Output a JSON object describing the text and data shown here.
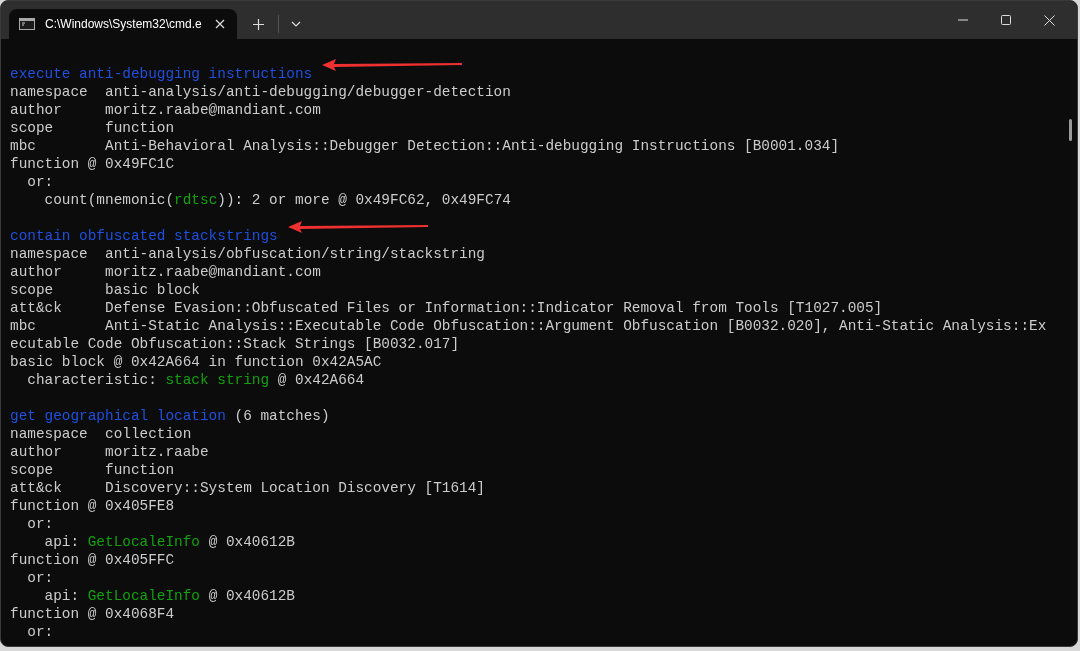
{
  "window": {
    "tab_title": "C:\\Windows\\System32\\cmd.e"
  },
  "blocks": [
    {
      "arrow": true,
      "lines": [
        {
          "segments": [
            {
              "text": "execute anti-debugging instructions",
              "kind": "heading"
            }
          ]
        },
        {
          "segments": [
            {
              "text": "namespace  anti-analysis/anti-debugging/debugger-detection",
              "kind": "plain"
            }
          ]
        },
        {
          "segments": [
            {
              "text": "author     moritz.raabe@mandiant.com",
              "kind": "plain"
            }
          ]
        },
        {
          "segments": [
            {
              "text": "scope      function",
              "kind": "plain"
            }
          ]
        },
        {
          "segments": [
            {
              "text": "mbc        Anti-Behavioral Analysis::Debugger Detection::Anti-debugging Instructions [B0001.034]",
              "kind": "plain"
            }
          ]
        },
        {
          "segments": [
            {
              "text": "function @ 0x49FC1C",
              "kind": "plain"
            }
          ]
        },
        {
          "segments": [
            {
              "text": "  or:",
              "kind": "plain"
            }
          ]
        },
        {
          "segments": [
            {
              "text": "    count(mnemonic(",
              "kind": "plain"
            },
            {
              "text": "rdtsc",
              "kind": "match"
            },
            {
              "text": ")): 2 or more @ 0x49FC62, 0x49FC74",
              "kind": "plain"
            }
          ]
        }
      ]
    },
    {
      "arrow": true,
      "lines": [
        {
          "segments": [
            {
              "text": "contain obfuscated stackstrings",
              "kind": "heading"
            }
          ]
        },
        {
          "segments": [
            {
              "text": "namespace  anti-analysis/obfuscation/string/stackstring",
              "kind": "plain"
            }
          ]
        },
        {
          "segments": [
            {
              "text": "author     moritz.raabe@mandiant.com",
              "kind": "plain"
            }
          ]
        },
        {
          "segments": [
            {
              "text": "scope      basic block",
              "kind": "plain"
            }
          ]
        },
        {
          "segments": [
            {
              "text": "att&ck     Defense Evasion::Obfuscated Files or Information::Indicator Removal from Tools [T1027.005]",
              "kind": "plain"
            }
          ]
        },
        {
          "segments": [
            {
              "text": "mbc        Anti-Static Analysis::Executable Code Obfuscation::Argument Obfuscation [B0032.020], Anti-Static Analysis::Ex",
              "kind": "plain"
            }
          ]
        },
        {
          "segments": [
            {
              "text": "ecutable Code Obfuscation::Stack Strings [B0032.017]",
              "kind": "plain"
            }
          ]
        },
        {
          "segments": [
            {
              "text": "basic block @ 0x42A664 in function 0x42A5AC",
              "kind": "plain"
            }
          ]
        },
        {
          "segments": [
            {
              "text": "  characteristic: ",
              "kind": "plain"
            },
            {
              "text": "stack string",
              "kind": "match"
            },
            {
              "text": " @ 0x42A664",
              "kind": "plain"
            }
          ]
        }
      ]
    },
    {
      "arrow": false,
      "lines": [
        {
          "segments": [
            {
              "text": "get geographical location",
              "kind": "heading"
            },
            {
              "text": " (6 matches)",
              "kind": "plain"
            }
          ]
        },
        {
          "segments": [
            {
              "text": "namespace  collection",
              "kind": "plain"
            }
          ]
        },
        {
          "segments": [
            {
              "text": "author     moritz.raabe",
              "kind": "plain"
            }
          ]
        },
        {
          "segments": [
            {
              "text": "scope      function",
              "kind": "plain"
            }
          ]
        },
        {
          "segments": [
            {
              "text": "att&ck     Discovery::System Location Discovery [T1614]",
              "kind": "plain"
            }
          ]
        },
        {
          "segments": [
            {
              "text": "function @ 0x405FE8",
              "kind": "plain"
            }
          ]
        },
        {
          "segments": [
            {
              "text": "  or:",
              "kind": "plain"
            }
          ]
        },
        {
          "segments": [
            {
              "text": "    api: ",
              "kind": "plain"
            },
            {
              "text": "GetLocaleInfo",
              "kind": "match"
            },
            {
              "text": " @ 0x40612B",
              "kind": "plain"
            }
          ]
        },
        {
          "segments": [
            {
              "text": "function @ 0x405FFC",
              "kind": "plain"
            }
          ]
        },
        {
          "segments": [
            {
              "text": "  or:",
              "kind": "plain"
            }
          ]
        },
        {
          "segments": [
            {
              "text": "    api: ",
              "kind": "plain"
            },
            {
              "text": "GetLocaleInfo",
              "kind": "match"
            },
            {
              "text": " @ 0x40612B",
              "kind": "plain"
            }
          ]
        },
        {
          "segments": [
            {
              "text": "function @ 0x4068F4",
              "kind": "plain"
            }
          ]
        },
        {
          "segments": [
            {
              "text": "  or:",
              "kind": "plain"
            }
          ]
        }
      ]
    }
  ]
}
